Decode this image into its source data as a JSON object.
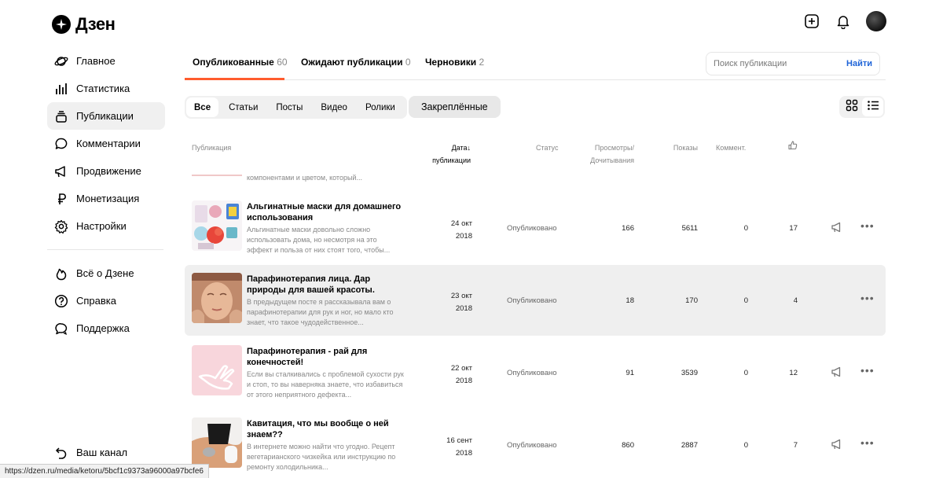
{
  "app": {
    "logo_text": "Дзен"
  },
  "sidebar": {
    "items": [
      {
        "label": "Главное",
        "icon": "planet-icon"
      },
      {
        "label": "Статистика",
        "icon": "bar-chart-icon"
      },
      {
        "label": "Публикации",
        "icon": "stack-icon"
      },
      {
        "label": "Комментарии",
        "icon": "speech-bubble-icon"
      },
      {
        "label": "Продвижение",
        "icon": "megaphone-icon"
      },
      {
        "label": "Монетизация",
        "icon": "ruble-icon"
      },
      {
        "label": "Настройки",
        "icon": "gear-icon"
      }
    ],
    "secondary": [
      {
        "label": "Всё о Дзене",
        "icon": "flame-icon"
      },
      {
        "label": "Справка",
        "icon": "question-icon"
      },
      {
        "label": "Поддержка",
        "icon": "chat-icon"
      }
    ],
    "bottom": {
      "label": "Ваш канал",
      "icon": "back-arrow-icon"
    }
  },
  "tabs": [
    {
      "label": "Опубликованные",
      "count": "60"
    },
    {
      "label": "Ожидают публикации",
      "count": "0"
    },
    {
      "label": "Черновики",
      "count": "2"
    }
  ],
  "search": {
    "placeholder": "Поиск публикации",
    "button": "Найти"
  },
  "filters": [
    "Все",
    "Статьи",
    "Посты",
    "Видео",
    "Ролики"
  ],
  "pinned_label": "Закреплённые",
  "columns": {
    "publication": "Публикация",
    "date_line1": "Дата",
    "date_line2": "публикации",
    "status": "Статус",
    "views_line1": "Просмотры/",
    "views_line2": "Дочитывания",
    "shows": "Показы",
    "comments": "Коммент."
  },
  "clipped_row_text": "компонентами и цветом, который...",
  "rows": [
    {
      "title": "Альгинатные маски для домашнего использования",
      "desc": "Альгинатные маски довольно сложно использовать дома, но несмотря на это эффект и польза от них стоят того, чтобы...",
      "date_line1": "24 окт",
      "date_line2": "2018",
      "status": "Опубликовано",
      "views": "166",
      "shows": "5611",
      "comments": "0",
      "likes": "17"
    },
    {
      "title": "Парафинотерапия лица. Дар природы для вашей красоты.",
      "desc": "В предыдущем посте я рассказывала вам о парафинотерапии для рук и ног, но мало кто знает, что такое чудодейственное...",
      "date_line1": "23 окт",
      "date_line2": "2018",
      "status": "Опубликовано",
      "views": "18",
      "shows": "170",
      "comments": "0",
      "likes": "4"
    },
    {
      "title": "Парафинотерапия - рай для конечностей!",
      "desc": "Если вы сталкивались с проблемой сухости рук и стоп, то вы наверняка знаете, что избавиться от этого неприятного дефекта...",
      "date_line1": "22 окт",
      "date_line2": "2018",
      "status": "Опубликовано",
      "views": "91",
      "shows": "3539",
      "comments": "0",
      "likes": "12"
    },
    {
      "title": "Кавитация, что мы вообще о ней знаем??",
      "desc": "В интернете можно найти что угодно. Рецепт вегетарианского чизкейка или инструкцию по ремонту холодильника...",
      "date_line1": "16 сент",
      "date_line2": "2018",
      "status": "Опубликовано",
      "views": "860",
      "shows": "2887",
      "comments": "0",
      "likes": "7"
    }
  ],
  "statusbar_url": "https://dzen.ru/media/ketoru/5bcf1c9373a96000a97bcfe6"
}
